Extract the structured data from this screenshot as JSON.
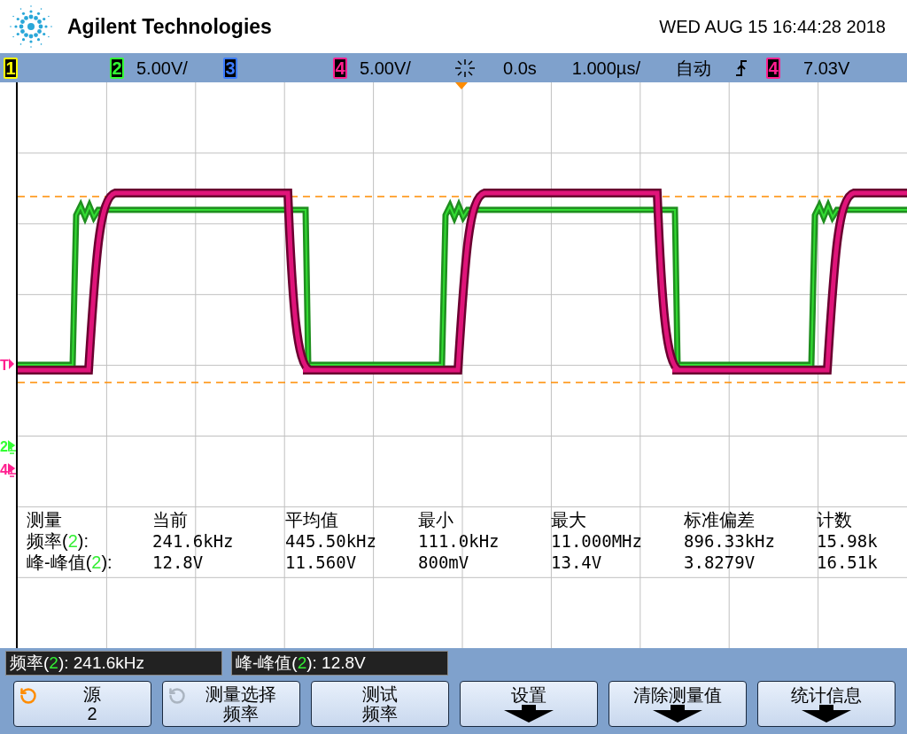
{
  "header": {
    "brand": "Agilent Technologies",
    "datetime": "WED AUG 15 16:44:28 2018"
  },
  "channel_bar": {
    "channels": [
      {
        "label": "1",
        "color": "#ffff00"
      },
      {
        "label": "2",
        "color": "#33ff33",
        "scale": "5.00V/"
      },
      {
        "label": "3",
        "color": "#3b7bff"
      },
      {
        "label": "4",
        "color": "#ff1f8f",
        "scale": "5.00V/"
      }
    ],
    "delay": "0.0s",
    "timebase": "1.000µs/",
    "trigger_mode": "自动",
    "trigger_source": {
      "label": "4",
      "color": "#ff1f8f"
    },
    "trigger_level": "7.03V"
  },
  "markers": [
    {
      "label": "T",
      "kind": "trigger",
      "color": "#ff1f8f"
    },
    {
      "label": "2",
      "kind": "ground",
      "color": "#33ff33"
    },
    {
      "label": "4",
      "kind": "ground",
      "color": "#ff1f8f"
    }
  ],
  "measurements": {
    "columns": [
      "测量",
      "当前",
      "平均值",
      "最小",
      "最大",
      "标准偏差",
      "计数"
    ],
    "rows": [
      {
        "prefix": "频率(",
        "source": "2",
        "suffix": "):",
        "values": [
          "241.6kHz",
          "445.50kHz",
          "111.0kHz",
          "11.000MHz",
          "896.33kHz",
          "15.98k"
        ]
      },
      {
        "prefix": "峰-峰值(",
        "source": "2",
        "suffix": "):",
        "values": [
          "12.8V",
          "11.560V",
          "800mV",
          "13.4V",
          "3.8279V",
          "16.51k"
        ]
      }
    ]
  },
  "readouts": [
    {
      "prefix": "频率(",
      "source": "2",
      "suffix": "): 241.6kHz"
    },
    {
      "prefix": "峰-峰值(",
      "source": "2",
      "suffix": "): 12.8V"
    }
  ],
  "softkeys": [
    {
      "kind": "knob",
      "active": true,
      "lines": [
        "源",
        "2"
      ]
    },
    {
      "kind": "knob",
      "active": false,
      "lines": [
        "测量选择",
        "频率"
      ]
    },
    {
      "kind": "text",
      "lines": [
        "测试",
        "频率"
      ]
    },
    {
      "kind": "menu",
      "lines": [
        "设置"
      ]
    },
    {
      "kind": "menu",
      "lines": [
        "清除测量值"
      ]
    },
    {
      "kind": "menu",
      "lines": [
        "统计信息"
      ]
    }
  ]
}
